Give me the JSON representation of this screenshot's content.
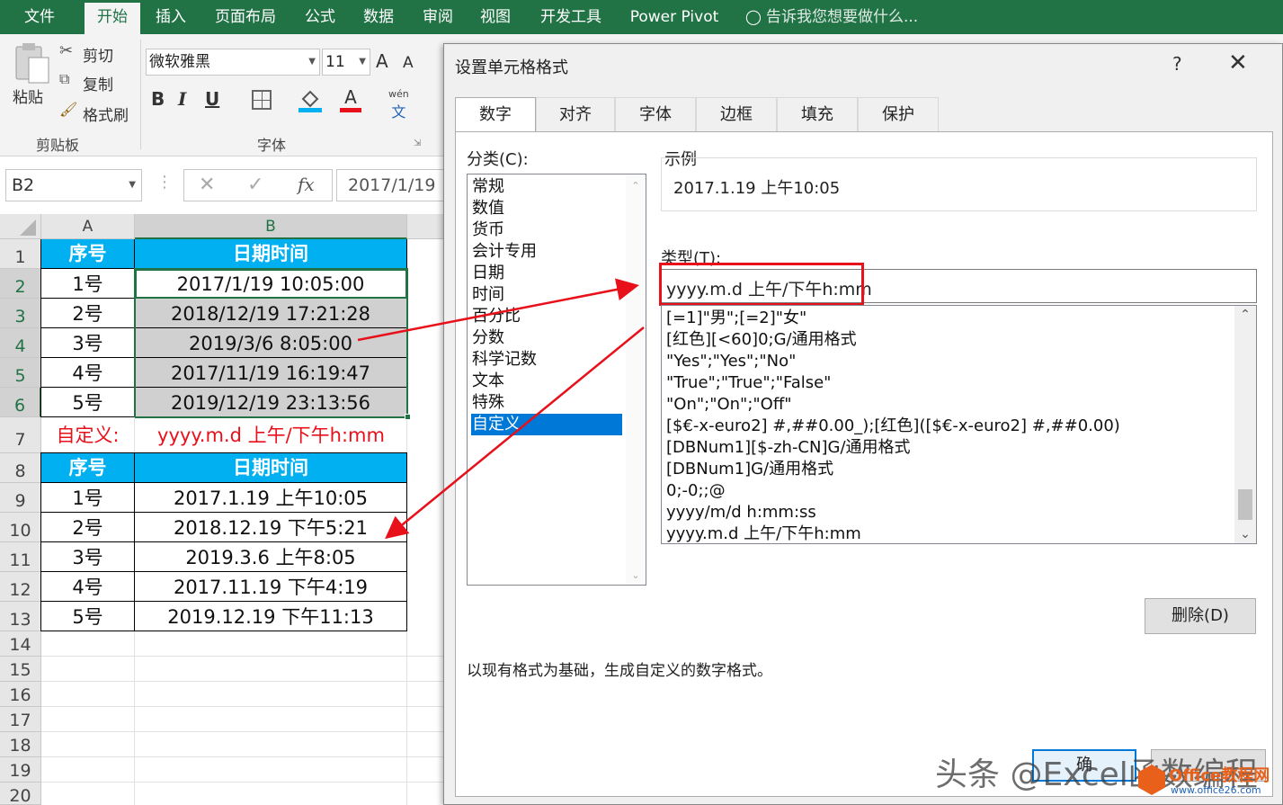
{
  "ribbon": {
    "tabs": [
      "文件",
      "开始",
      "插入",
      "页面布局",
      "公式",
      "数据",
      "审阅",
      "视图",
      "开发工具",
      "Power Pivot"
    ],
    "tell_me": "告诉我您想要做什么...",
    "paste": "粘贴",
    "cut": "剪切",
    "copy": "复制",
    "format_painter": "格式刷",
    "clipboard_group": "剪贴板",
    "font_name": "微软雅黑",
    "font_size": "11",
    "font_group": "字体",
    "phonetic": "wén",
    "bold": "B",
    "italic": "I",
    "underline": "U",
    "grow_font": "A",
    "shrink_font": "A",
    "font_color_glyph": "A"
  },
  "formula_bar": {
    "name_box": "B2",
    "fx": "fx",
    "content": "2017/1/19"
  },
  "sheet": {
    "col_headers": [
      "A",
      "B"
    ],
    "row_headers": [
      "1",
      "2",
      "3",
      "4",
      "5",
      "6",
      "7",
      "8",
      "9",
      "10",
      "11",
      "12",
      "13",
      "14",
      "15",
      "16",
      "17",
      "18",
      "19",
      "20"
    ],
    "header1": {
      "a": "序号",
      "b": "日期时间"
    },
    "rows1": [
      {
        "a": "1号",
        "b": "2017/1/19 10:05:00"
      },
      {
        "a": "2号",
        "b": "2018/12/19 17:21:28"
      },
      {
        "a": "3号",
        "b": "2019/3/6 8:05:00"
      },
      {
        "a": "4号",
        "b": "2017/11/19 16:19:47"
      },
      {
        "a": "5号",
        "b": "2019/12/19 23:13:56"
      }
    ],
    "custom_label": "自定义:",
    "custom_format": "yyyy.m.d 上午/下午h:mm",
    "header2": {
      "a": "序号",
      "b": "日期时间"
    },
    "rows2": [
      {
        "a": "1号",
        "b": "2017.1.19 上午10:05"
      },
      {
        "a": "2号",
        "b": "2018.12.19 下午5:21"
      },
      {
        "a": "3号",
        "b": "2019.3.6 上午8:05"
      },
      {
        "a": "4号",
        "b": "2017.11.19 下午4:19"
      },
      {
        "a": "5号",
        "b": "2019.12.19 下午11:13"
      }
    ]
  },
  "dialog": {
    "title": "设置单元格格式",
    "help": "?",
    "tabs": [
      "数字",
      "对齐",
      "字体",
      "边框",
      "填充",
      "保护"
    ],
    "category_label": "分类(C):",
    "categories": [
      "常规",
      "数值",
      "货币",
      "会计专用",
      "日期",
      "时间",
      "百分比",
      "分数",
      "科学记数",
      "文本",
      "特殊",
      "自定义"
    ],
    "selected_category": "自定义",
    "sample_label": "示例",
    "sample_value": "2017.1.19 上午10:05",
    "type_label": "类型(T):",
    "type_value": "yyyy.m.d 上午/下午h:mm",
    "formats": [
      "[=1]\"男\";[=2]\"女\"",
      "[红色][<60]0;G/通用格式",
      "\"Yes\";\"Yes\";\"No\"",
      "\"True\";\"True\";\"False\"",
      "\"On\";\"On\";\"Off\"",
      "[$€-x-euro2] #,##0.00_);[红色]([$€-x-euro2] #,##0.00)",
      "[DBNum1][$-zh-CN]G/通用格式",
      "[DBNum1]G/通用格式",
      "0;-0;;@",
      "yyyy/m/d h:mm:ss",
      "yyyy.m.d 上午/下午h:mm"
    ],
    "delete_button": "删除(D)",
    "description": "以现有格式为基础，生成自定义的数字格式。",
    "ok_partial": "确"
  },
  "watermark": "头条 @Excel函数编程",
  "logo_text": "Office教程网",
  "logo_url": "www.office26.com",
  "colors": {
    "excel_green": "#217346",
    "header_blue": "#00b0f0",
    "red": "#e8101a",
    "select_blue": "#0078d7"
  }
}
